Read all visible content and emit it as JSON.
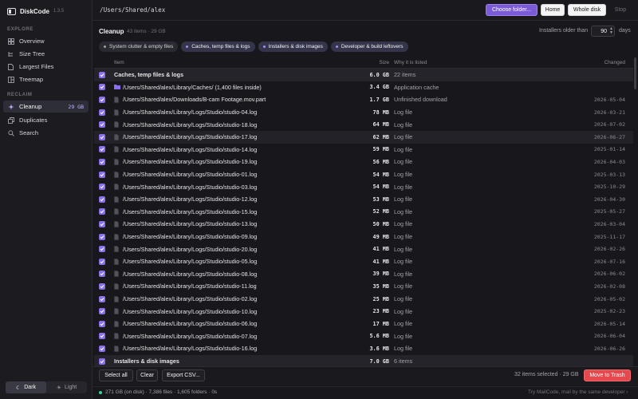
{
  "app": {
    "name": "DiskCode",
    "version": "1.3.5"
  },
  "sidebar": {
    "explore_label": "EXPLORE",
    "explore_items": [
      {
        "label": "Overview",
        "icon": "grid-icon"
      },
      {
        "label": "Size Tree",
        "icon": "tree-icon"
      },
      {
        "label": "Largest Files",
        "icon": "file-icon"
      },
      {
        "label": "Treemap",
        "icon": "treemap-icon"
      }
    ],
    "reclaim_label": "RECLAIM",
    "reclaim_items": [
      {
        "label": "Cleanup",
        "icon": "sparkle-icon",
        "badge": "29 GB",
        "active": true
      },
      {
        "label": "Duplicates",
        "icon": "duplicate-icon"
      },
      {
        "label": "Search",
        "icon": "search-icon"
      }
    ],
    "theme": {
      "dark": "Dark",
      "light": "Light",
      "selected": "Dark"
    }
  },
  "topbar": {
    "path": "/Users/Shared/alex",
    "choose_folder": "Choose folder...",
    "home": "Home",
    "whole_disk": "Whole disk",
    "stop": "Stop"
  },
  "cleanup": {
    "title": "Cleanup",
    "meta": "43 items · 29 GB",
    "older_label": "Installers older than",
    "older_value": "90",
    "older_unit": "days",
    "chips": [
      {
        "label": "System clutter & empty files",
        "active": false
      },
      {
        "label": "Caches, temp files & logs",
        "active": true
      },
      {
        "label": "Installers & disk images",
        "active": true
      },
      {
        "label": "Developer & build leftovers",
        "active": true
      }
    ]
  },
  "table": {
    "headers": {
      "item": "Item",
      "size": "Size",
      "why": "Why it is listed",
      "changed": "Changed"
    },
    "rows": [
      {
        "type": "group",
        "item": "Caches, temp files & logs",
        "size": "6.0 GB",
        "why": "22 items",
        "changed": ""
      },
      {
        "type": "folder",
        "item": "/Users/Shared/alex/Library/Caches/ (1,400 files inside)",
        "size": "3.4 GB",
        "why": "Application cache",
        "changed": ""
      },
      {
        "type": "file",
        "item": "/Users/Shared/alex/Downloads/B-cam Footage.mov.part",
        "size": "1.7 GB",
        "why": "Unfinished download",
        "changed": "2026-05-04"
      },
      {
        "type": "file",
        "item": "/Users/Shared/alex/Library/Logs/Studio/studio-04.log",
        "size": "78 MB",
        "why": "Log file",
        "changed": "2026-03-21"
      },
      {
        "type": "file",
        "item": "/Users/Shared/alex/Library/Logs/Studio/studio-18.log",
        "size": "64 MB",
        "why": "Log file",
        "changed": "2026-07-02"
      },
      {
        "type": "file",
        "item": "/Users/Shared/alex/Library/Logs/Studio/studio-17.log",
        "size": "62 MB",
        "why": "Log file",
        "changed": "2026-06-27",
        "hl": true
      },
      {
        "type": "file",
        "item": "/Users/Shared/alex/Library/Logs/Studio/studio-14.log",
        "size": "59 MB",
        "why": "Log file",
        "changed": "2025-01-14"
      },
      {
        "type": "file",
        "item": "/Users/Shared/alex/Library/Logs/Studio/studio-19.log",
        "size": "56 MB",
        "why": "Log file",
        "changed": "2026-04-03"
      },
      {
        "type": "file",
        "item": "/Users/Shared/alex/Library/Logs/Studio/studio-01.log",
        "size": "54 MB",
        "why": "Log file",
        "changed": "2025-03-13"
      },
      {
        "type": "file",
        "item": "/Users/Shared/alex/Library/Logs/Studio/studio-03.log",
        "size": "54 MB",
        "why": "Log file",
        "changed": "2025-10-29"
      },
      {
        "type": "file",
        "item": "/Users/Shared/alex/Library/Logs/Studio/studio-12.log",
        "size": "53 MB",
        "why": "Log file",
        "changed": "2026-04-30"
      },
      {
        "type": "file",
        "item": "/Users/Shared/alex/Library/Logs/Studio/studio-15.log",
        "size": "52 MB",
        "why": "Log file",
        "changed": "2025-05-27"
      },
      {
        "type": "file",
        "item": "/Users/Shared/alex/Library/Logs/Studio/studio-13.log",
        "size": "50 MB",
        "why": "Log file",
        "changed": "2026-03-04"
      },
      {
        "type": "file",
        "item": "/Users/Shared/alex/Library/Logs/Studio/studio-09.log",
        "size": "49 MB",
        "why": "Log file",
        "changed": "2025-11-17"
      },
      {
        "type": "file",
        "item": "/Users/Shared/alex/Library/Logs/Studio/studio-20.log",
        "size": "41 MB",
        "why": "Log file",
        "changed": "2026-02-26"
      },
      {
        "type": "file",
        "item": "/Users/Shared/alex/Library/Logs/Studio/studio-05.log",
        "size": "41 MB",
        "why": "Log file",
        "changed": "2026-07-16"
      },
      {
        "type": "file",
        "item": "/Users/Shared/alex/Library/Logs/Studio/studio-08.log",
        "size": "39 MB",
        "why": "Log file",
        "changed": "2026-06-02"
      },
      {
        "type": "file",
        "item": "/Users/Shared/alex/Library/Logs/Studio/studio-11.log",
        "size": "35 MB",
        "why": "Log file",
        "changed": "2026-02-08"
      },
      {
        "type": "file",
        "item": "/Users/Shared/alex/Library/Logs/Studio/studio-02.log",
        "size": "25 MB",
        "why": "Log file",
        "changed": "2026-05-02"
      },
      {
        "type": "file",
        "item": "/Users/Shared/alex/Library/Logs/Studio/studio-10.log",
        "size": "23 MB",
        "why": "Log file",
        "changed": "2025-02-23"
      },
      {
        "type": "file",
        "item": "/Users/Shared/alex/Library/Logs/Studio/studio-06.log",
        "size": "17 MB",
        "why": "Log file",
        "changed": "2026-05-14"
      },
      {
        "type": "file",
        "item": "/Users/Shared/alex/Library/Logs/Studio/studio-07.log",
        "size": "5.6 MB",
        "why": "Log file",
        "changed": "2026-06-04"
      },
      {
        "type": "file",
        "item": "/Users/Shared/alex/Library/Logs/Studio/studio-16.log",
        "size": "3.6 MB",
        "why": "Log file",
        "changed": "2026-06-26"
      },
      {
        "type": "group",
        "item": "Installers & disk images",
        "size": "7.0 GB",
        "why": "6 items",
        "changed": ""
      }
    ]
  },
  "footer": {
    "select_all": "Select all",
    "clear": "Clear",
    "export_csv": "Export CSV...",
    "selected_info": "32 items selected · 29 GB",
    "move_to_trash": "Move to Trash"
  },
  "status": {
    "text": "271 GB (on disk) · 7,386 files · 1,605 folders · 0s",
    "promo": "Try MailCode, mail by the same developer ›"
  },
  "colors": {
    "accent": "#7c5cd6",
    "checkbox": "#8b6ff0",
    "danger": "#e5484d",
    "status_ok": "#34d399"
  }
}
